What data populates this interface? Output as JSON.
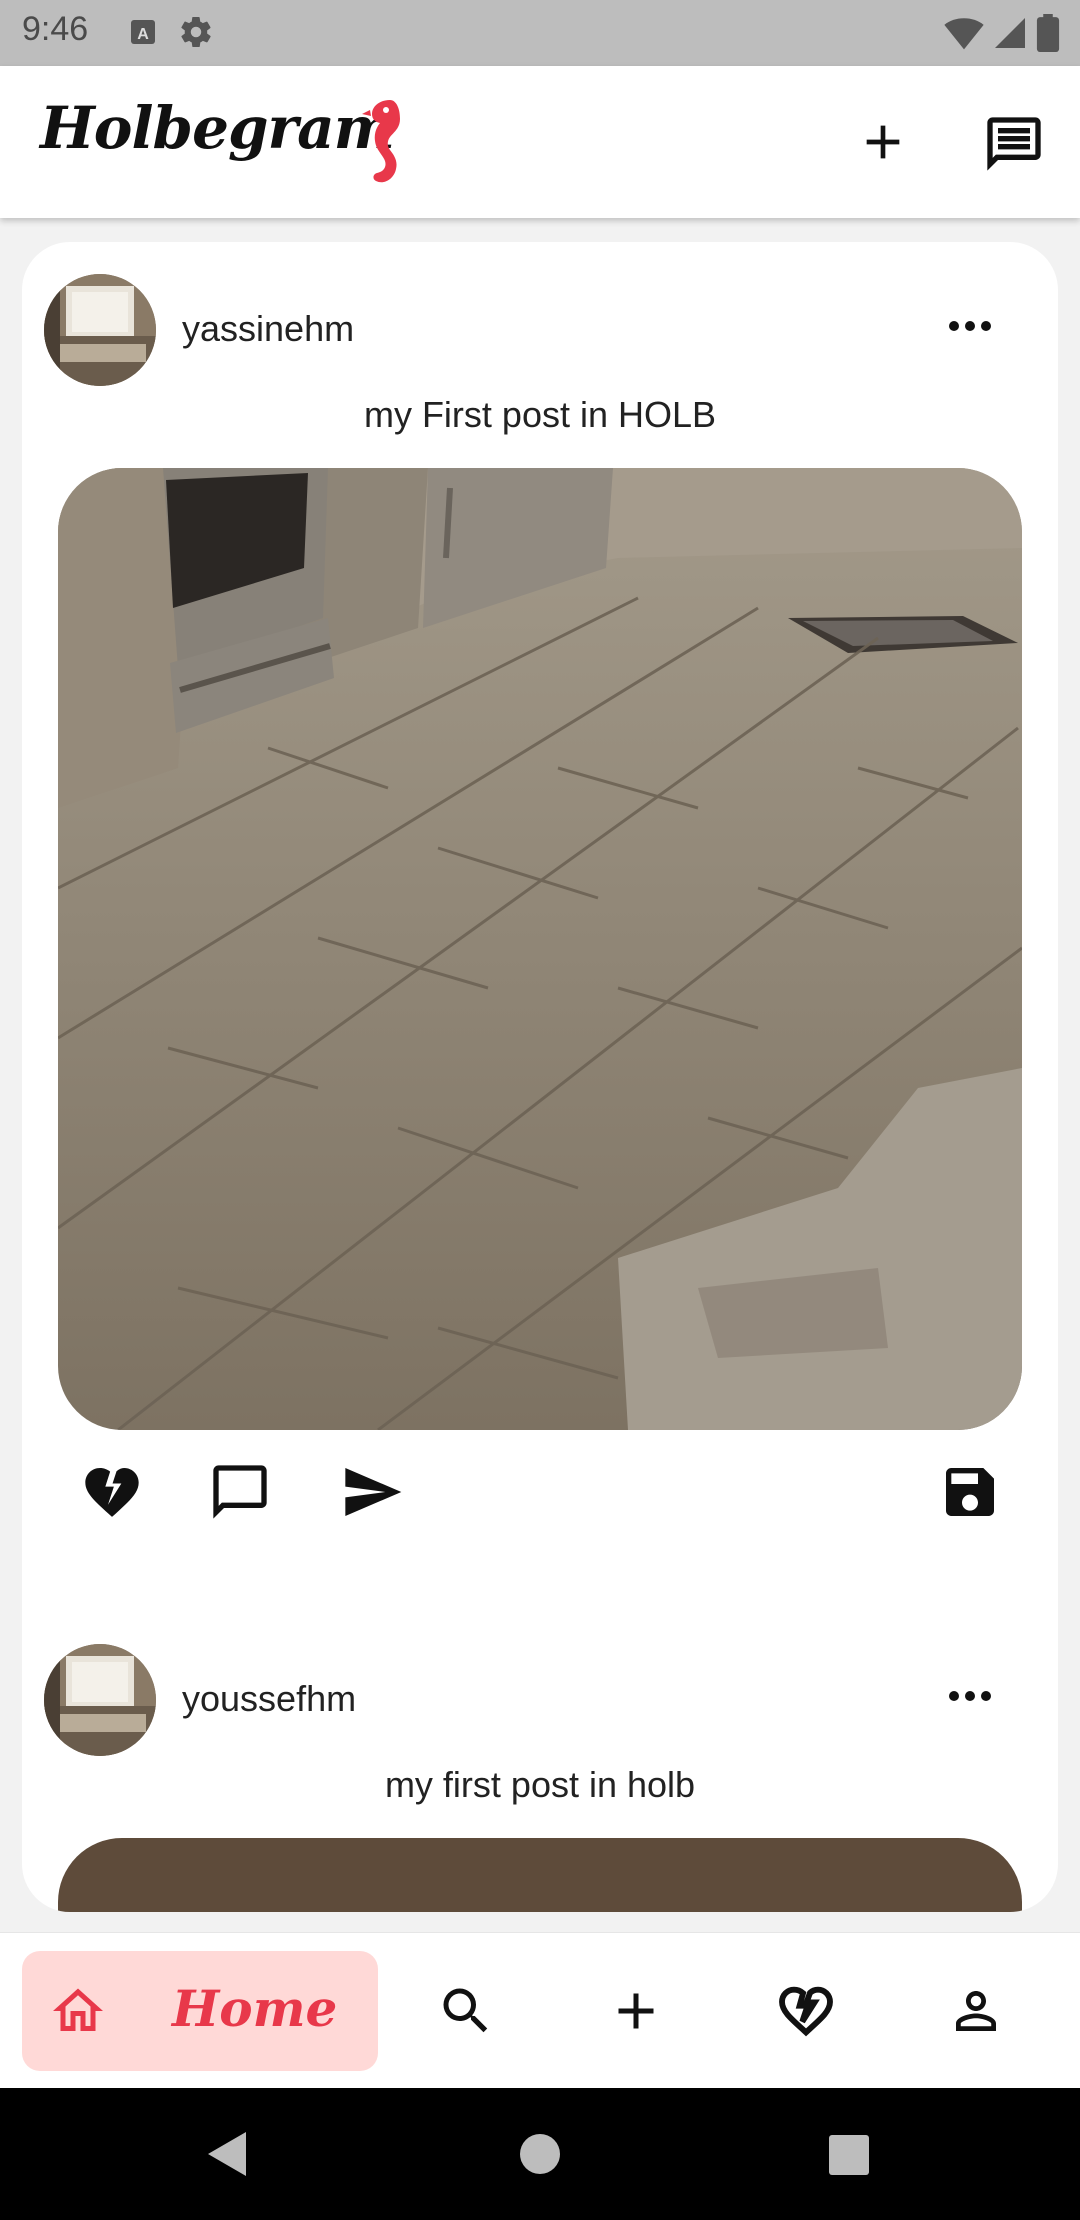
{
  "status_bar": {
    "time": "9:46",
    "icons": [
      "keyboard-a-icon",
      "settings-icon",
      "wifi-icon",
      "signal-icon",
      "battery-icon"
    ]
  },
  "app_bar": {
    "title": "Holbegram",
    "icons": [
      "seahorse-logo-icon",
      "add-icon",
      "messages-icon"
    ],
    "accent_color": "#e8384a"
  },
  "posts": [
    {
      "username": "yassinehm",
      "caption": "my First post in HOLB",
      "actions": [
        "broken-heart-icon",
        "comment-icon",
        "send-icon",
        "save-icon"
      ]
    },
    {
      "username": "youssefhm",
      "caption": "my first post in holb"
    }
  ],
  "bottom_nav": {
    "items": [
      {
        "label": "Home",
        "icon": "home-icon",
        "active": true
      },
      {
        "icon": "search-icon"
      },
      {
        "icon": "add-icon"
      },
      {
        "icon": "broken-heart-icon"
      },
      {
        "icon": "profile-icon"
      }
    ],
    "active_color": "#e8384a",
    "active_bg": "#ffd9d7"
  },
  "system_nav": [
    "back-icon",
    "home-circle-icon",
    "recents-icon"
  ]
}
